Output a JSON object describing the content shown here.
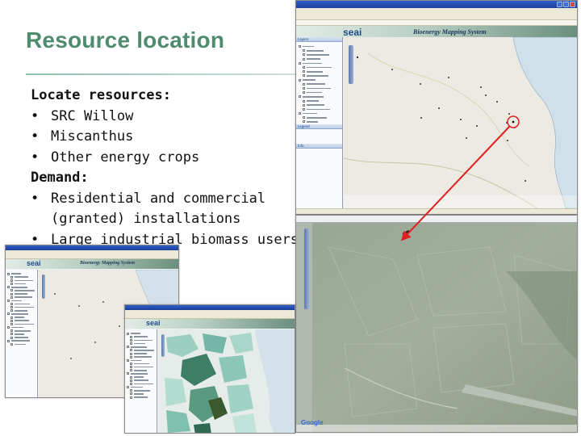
{
  "slide": {
    "title": "Resource location",
    "bullets": {
      "heading_resources": "Locate resources:",
      "item_willow": "SRC Willow",
      "item_miscanthus": "Miscanthus",
      "item_other": "Other energy crops",
      "heading_demand": "Demand:",
      "item_residential_line1": "Residential and commercial",
      "item_residential_line2": "(granted) installations",
      "item_industrial": "Large industrial biomass users",
      "bullet_glyph": "•"
    }
  },
  "screenshot_main": {
    "logo": "seai",
    "system_name": "Bioenergy Mapping System",
    "panels": {
      "layers": "Layers",
      "legend": "Legend",
      "info": "Info"
    }
  },
  "screenshot_satellite": {
    "attribution": "Google"
  },
  "screenshot_small_left": {
    "logo": "seai",
    "system_name": "Bioenergy Mapping System"
  },
  "screenshot_small_center": {
    "logo": "seai"
  },
  "colors": {
    "title": "#4f8c6e",
    "highlight_circle": "#e02020",
    "pointer_arrow": "#e02020",
    "window_titlebar": "#1c3f9a"
  }
}
